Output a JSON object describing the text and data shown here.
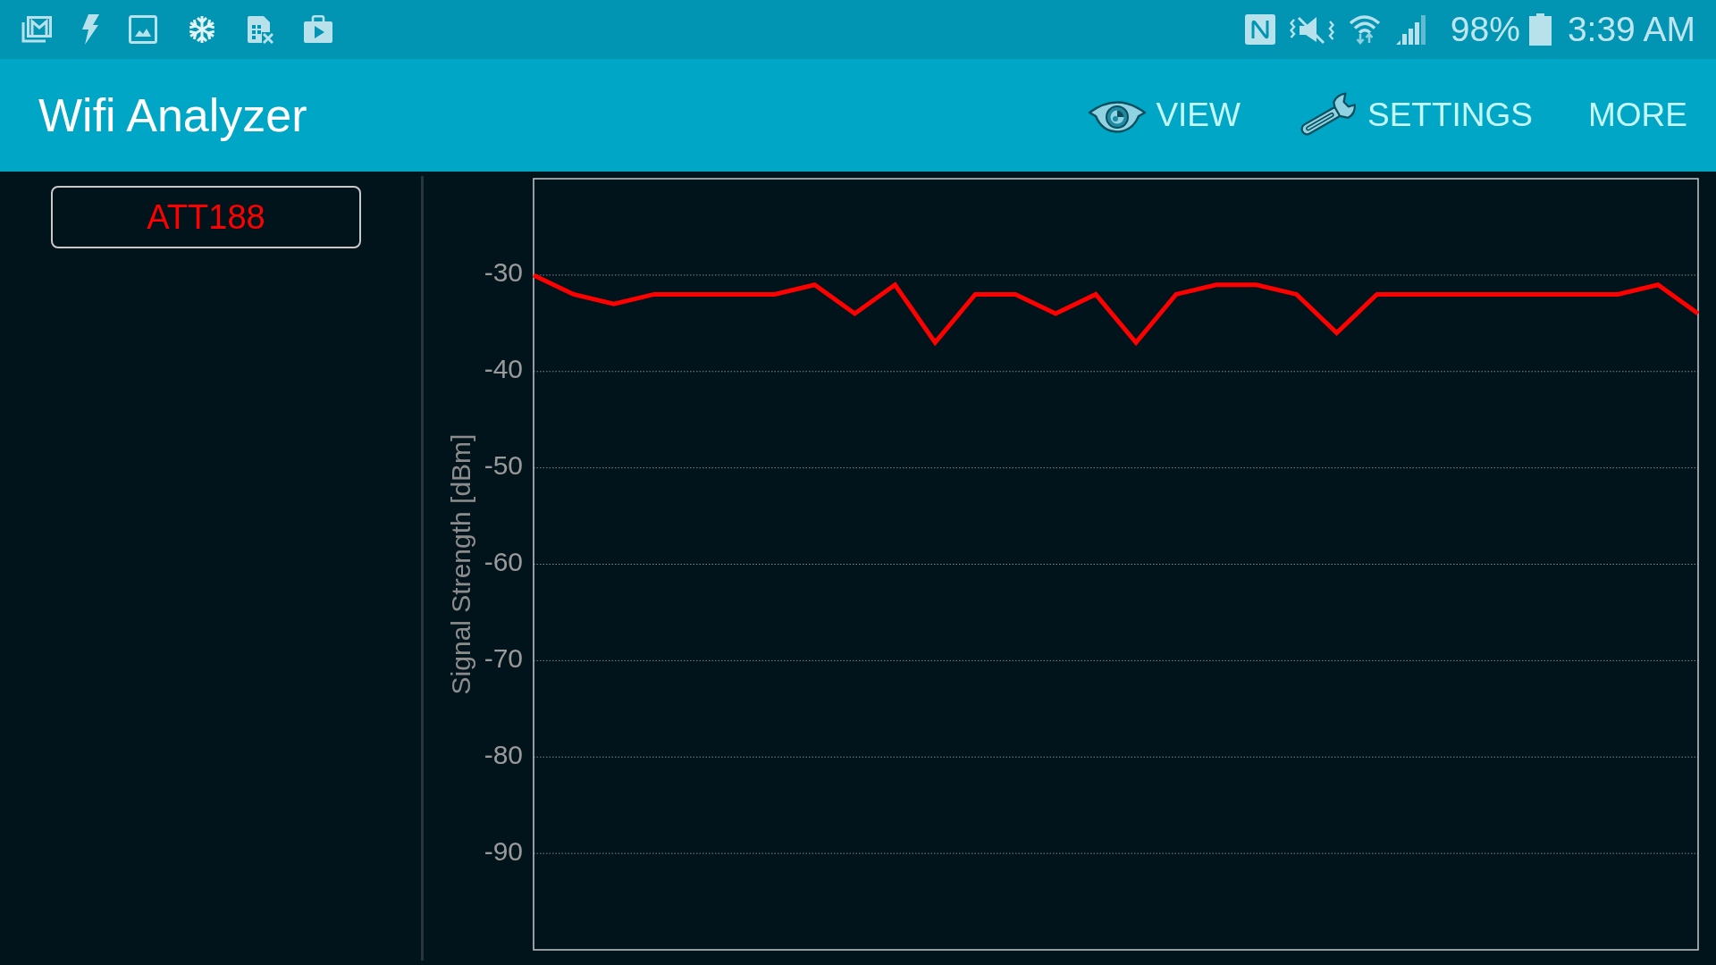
{
  "status_bar": {
    "battery": "98%",
    "time": "3:39 AM"
  },
  "app_bar": {
    "title": "Wifi Analyzer",
    "actions": [
      "VIEW",
      "SETTINGS",
      "MORE"
    ]
  },
  "graph": {
    "chart_data": {
      "type": "line",
      "ylabel": "Signal Strength [dBm]",
      "ylim": [
        -100,
        -20
      ],
      "yticks": [
        -30,
        -40,
        -50,
        -60,
        -70,
        -80,
        -90
      ],
      "grid": true,
      "series": [
        {
          "name": "ATT188",
          "color": "#ff0000",
          "values": [
            -30,
            -32,
            -33,
            -32,
            -32,
            -32,
            -32,
            -31,
            -34,
            -31,
            -37,
            -32,
            -32,
            -34,
            -32,
            -37,
            -32,
            -31,
            -31,
            -32,
            -36,
            -32,
            -32,
            -32,
            -32,
            -32,
            -32,
            -32,
            -31,
            -34
          ]
        }
      ]
    }
  }
}
